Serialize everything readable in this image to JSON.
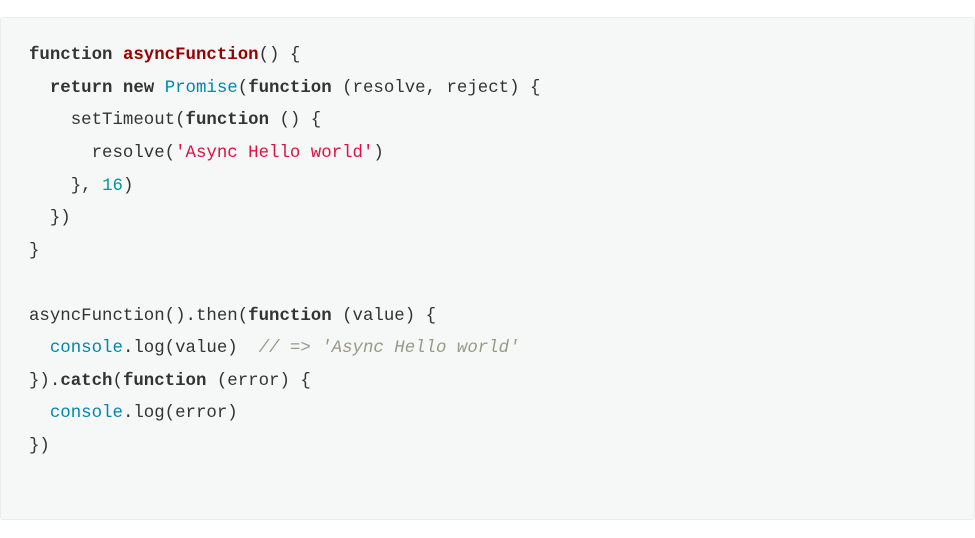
{
  "code": {
    "lines": [
      [
        {
          "t": "function ",
          "c": "keyword"
        },
        {
          "t": "asyncFunction",
          "c": "fname"
        },
        {
          "t": "() {",
          "c": "plain"
        }
      ],
      [
        {
          "t": "  ",
          "c": "plain"
        },
        {
          "t": "return new",
          "c": "keyword"
        },
        {
          "t": " ",
          "c": "plain"
        },
        {
          "t": "Promise",
          "c": "class"
        },
        {
          "t": "(",
          "c": "plain"
        },
        {
          "t": "function",
          "c": "keyword"
        },
        {
          "t": " (resolve, reject) {",
          "c": "plain"
        }
      ],
      [
        {
          "t": "    setTimeout(",
          "c": "plain"
        },
        {
          "t": "function",
          "c": "keyword"
        },
        {
          "t": " () {",
          "c": "plain"
        }
      ],
      [
        {
          "t": "      resolve(",
          "c": "plain"
        },
        {
          "t": "'Async Hello world'",
          "c": "string"
        },
        {
          "t": ")",
          "c": "plain"
        }
      ],
      [
        {
          "t": "    }, ",
          "c": "plain"
        },
        {
          "t": "16",
          "c": "number"
        },
        {
          "t": ")",
          "c": "plain"
        }
      ],
      [
        {
          "t": "  })",
          "c": "plain"
        }
      ],
      [
        {
          "t": "}",
          "c": "plain"
        }
      ],
      [
        {
          "t": "",
          "c": "plain"
        }
      ],
      [
        {
          "t": "asyncFunction().then(",
          "c": "plain"
        },
        {
          "t": "function",
          "c": "keyword"
        },
        {
          "t": " (value) {",
          "c": "plain"
        }
      ],
      [
        {
          "t": "  ",
          "c": "plain"
        },
        {
          "t": "console",
          "c": "builtin"
        },
        {
          "t": ".log(value)  ",
          "c": "plain"
        },
        {
          "t": "// => 'Async Hello world'",
          "c": "comment"
        }
      ],
      [
        {
          "t": "}).",
          "c": "plain"
        },
        {
          "t": "catch",
          "c": "keyword"
        },
        {
          "t": "(",
          "c": "plain"
        },
        {
          "t": "function",
          "c": "keyword"
        },
        {
          "t": " (error) {",
          "c": "plain"
        }
      ],
      [
        {
          "t": "  ",
          "c": "plain"
        },
        {
          "t": "console",
          "c": "builtin"
        },
        {
          "t": ".log(error)",
          "c": "plain"
        }
      ],
      [
        {
          "t": "})",
          "c": "plain"
        }
      ]
    ]
  }
}
